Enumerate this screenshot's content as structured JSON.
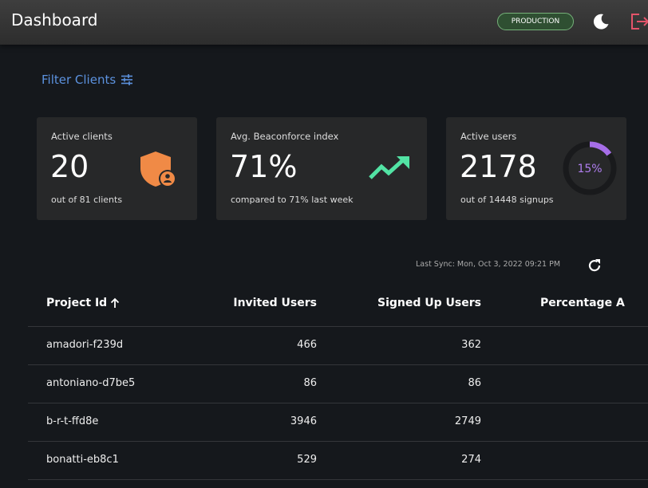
{
  "header": {
    "title": "Dashboard",
    "env_badge": "PRODUCTION"
  },
  "filter": {
    "label": "Filter Clients"
  },
  "cards": {
    "clients": {
      "label": "Active clients",
      "value": "20",
      "sub": "out of 81 clients"
    },
    "index": {
      "label": "Avg. Beaconforce index",
      "value": "71%",
      "sub": "compared to 71% last week"
    },
    "users": {
      "label": "Active users",
      "value": "2178",
      "sub": "out of 14448 signups",
      "percent_label": "15%",
      "percent": 0.15
    }
  },
  "sync": {
    "text": "Last Sync: Mon, Oct 3, 2022 09:21 PM"
  },
  "table": {
    "headers": {
      "project": "Project Id",
      "invited": "Invited Users",
      "signed": "Signed Up Users",
      "percentage": "Percentage A"
    },
    "rows": [
      {
        "project": "amadori-f239d",
        "invited": "466",
        "signed": "362"
      },
      {
        "project": "antoniano-d7be5",
        "invited": "86",
        "signed": "86"
      },
      {
        "project": "b-r-t-ffd8e",
        "invited": "3946",
        "signed": "2749"
      },
      {
        "project": "bonatti-eb8c1",
        "invited": "529",
        "signed": "274"
      }
    ]
  },
  "colors": {
    "accent_blue": "#5c92df",
    "shield_orange": "#f08a46",
    "trend_green": "#52e3a4",
    "ring_purple": "#a66ee8",
    "badge_green": "#2f4f32"
  }
}
